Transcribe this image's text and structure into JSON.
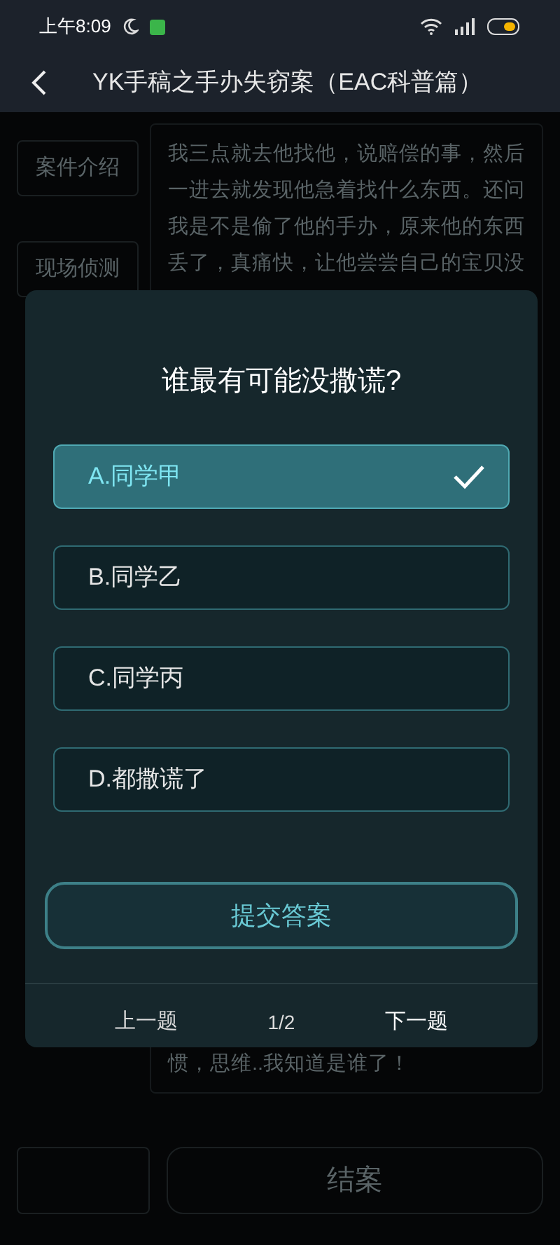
{
  "status_bar": {
    "time": "上午8:09"
  },
  "header": {
    "title": "YK手稿之手办失窃案（EAC科普篇）"
  },
  "sidebar": {
    "items": [
      {
        "label": "案件介绍"
      },
      {
        "label": "现场侦测"
      }
    ]
  },
  "story": {
    "lines_top": [
      "我三点就去他找他，说赔偿的事，然后",
      "一进去就发现他急着找什么东西。还问",
      "我是不是偷了他的手办，原来他的东西",
      "丢了，真痛快，让他尝尝自己的宝贝没"
    ],
    "lines_bottom": [
      "惯，思维..我知道是谁了！"
    ]
  },
  "bottom_bar": {
    "end_button": "结案"
  },
  "quiz": {
    "question": "谁最有可能没撒谎?",
    "options": [
      {
        "label": "A.同学甲",
        "selected": true
      },
      {
        "label": "B.同学乙",
        "selected": false
      },
      {
        "label": "C.同学丙",
        "selected": false
      },
      {
        "label": "D.都撒谎了",
        "selected": false
      }
    ],
    "submit": "提交答案",
    "prev": "上一题",
    "page": "1/2",
    "next": "下一题"
  }
}
